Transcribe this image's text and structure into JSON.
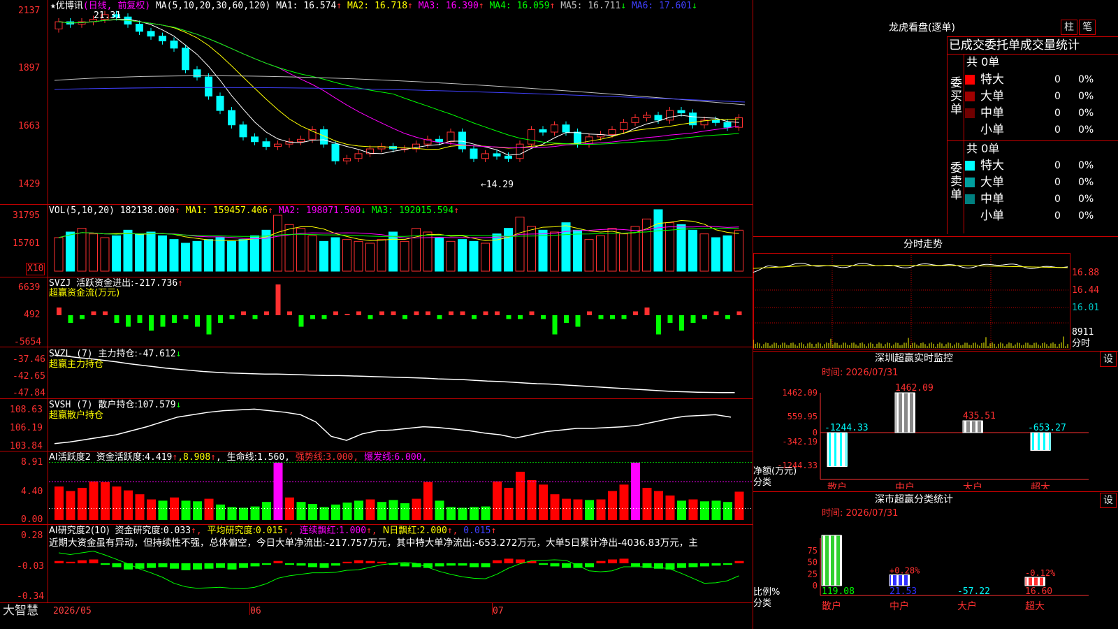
{
  "stock": {
    "name": "优博讯",
    "period": "(日线, 前复权)",
    "ma_params": "MA(5,10,20,30,60,120)",
    "ma": [
      {
        "label": "MA1:",
        "value": "16.574",
        "arrow": "↑",
        "color": "#ffffff"
      },
      {
        "label": "MA2:",
        "value": "16.718",
        "arrow": "↑",
        "color": "#ffff00"
      },
      {
        "label": "MA3:",
        "value": "16.390",
        "arrow": "↑",
        "color": "#ff00ff"
      },
      {
        "label": "MA4:",
        "value": "16.059",
        "arrow": "↑",
        "color": "#00ff00"
      },
      {
        "label": "MA5:",
        "value": "16.711",
        "arrow": "↓",
        "color": "#c0c0c0"
      },
      {
        "label": "MA6:",
        "value": "17.601",
        "arrow": "↓",
        "color": "#4040ff"
      }
    ],
    "price_axis": [
      "2137",
      "1897",
      "1663",
      "1429"
    ],
    "high_mark": "21.31",
    "low_mark": "←14.29"
  },
  "vol": {
    "title": "VOL(5,10,20)",
    "value": "182138.000",
    "ma": [
      {
        "label": "MA1:",
        "value": "159457.406",
        "arrow": "↑",
        "color": "#ffff00"
      },
      {
        "label": "MA2:",
        "value": "198071.500",
        "arrow": "↓",
        "color": "#ff00ff"
      },
      {
        "label": "MA3:",
        "value": "192015.594",
        "arrow": "↑",
        "color": "#00ff00"
      }
    ],
    "axis": [
      "31795",
      "15701"
    ],
    "unit": "X10"
  },
  "svzj": {
    "title": "SVZJ",
    "label": "活跃资金进出:",
    "value": "-217.736",
    "arrow": "↑",
    "subtitle": "超赢资金流(万元)",
    "axis": [
      "6639",
      "492",
      "-5654"
    ]
  },
  "svzl": {
    "title": "SVZL (7)",
    "label": "主力持仓:",
    "value": "-47.612",
    "arrow": "↓",
    "subtitle": "超赢主力持仓",
    "axis": [
      "-37.46",
      "-42.65",
      "-47.84"
    ]
  },
  "svsh": {
    "title": "SVSH (7)",
    "label": "散户持仓:",
    "value": "107.579",
    "arrow": "↓",
    "subtitle": "超赢散户持仓",
    "axis": [
      "108.63",
      "106.19",
      "103.84"
    ]
  },
  "ai1": {
    "title": "AI活跃度2",
    "label": "资金活跃度:",
    "value": "4.419",
    "arrow": "↑",
    "v2": "8.908",
    "life_label": "生命线:",
    "life_value": "1.560",
    "strong_label": "强势线:",
    "strong_value": "3.000",
    "burst_label": "爆发线:",
    "burst_value": "6.000",
    "axis": [
      "8.91",
      "4.40",
      "0.00"
    ]
  },
  "ai2": {
    "title": "AI研究度2(10)",
    "label": "资金研究度:",
    "value": "0.033",
    "avg_label": "平均研究度:",
    "avg_value": "0.015",
    "lian_label": "连续飘红:",
    "lian_value": "1.000",
    "n_label": "N日飘红:",
    "n_value": "2.000",
    "last_value": "0.015",
    "comment": "近期大资金虽有异动，但持续性不强，总体偏空，今日大单净流出:-217.757万元，其中特大单净流出:-653.272万元，大单5日累计净出-4036.83万元，主",
    "axis": [
      "0.28",
      "-0.03",
      "-0.34"
    ]
  },
  "bottom": {
    "brand": "大智慧",
    "dates": [
      "2026/05",
      "06",
      "07"
    ]
  },
  "lhb": {
    "title": "龙虎看盘(逐单)",
    "btn1": "柱",
    "btn2": "笔",
    "header": "已成交委托单成交量统计",
    "buy_label": "委买单",
    "sell_label": "委卖单",
    "buy_total": "共 0单",
    "sell_total": "共 0单",
    "buy_rows": [
      {
        "name": "特大",
        "val": "0",
        "pct": "0%",
        "color": "#ff0000"
      },
      {
        "name": "大单",
        "val": "0",
        "pct": "0%",
        "color": "#a00000"
      },
      {
        "name": "中单",
        "val": "0",
        "pct": "0%",
        "color": "#700000"
      },
      {
        "name": "小单",
        "val": "0",
        "pct": "0%",
        "color": "#000000"
      }
    ],
    "sell_rows": [
      {
        "name": "特大",
        "val": "0",
        "pct": "0%",
        "color": "#00ffff"
      },
      {
        "name": "大单",
        "val": "0",
        "pct": "0%",
        "color": "#00a0a0"
      },
      {
        "name": "中单",
        "val": "0",
        "pct": "0%",
        "color": "#008080"
      },
      {
        "name": "小单",
        "val": "0",
        "pct": "0%",
        "color": "#000000"
      }
    ]
  },
  "intraday": {
    "title": "分时走势",
    "axis": [
      "16.88",
      "16.44",
      "16.01"
    ],
    "vol_label": "8911",
    "vol_unit": "分时"
  },
  "sz_monitor": {
    "title": "深圳超赢实时监控",
    "btn": "设",
    "time": "时间: 2026/07/31",
    "axis": [
      "1462.09",
      "559.95",
      "0",
      "-342.19",
      "-1244.33"
    ],
    "ylabel1": "净额(万元)",
    "ylabel2": "分类",
    "categories": [
      "散户",
      "中户",
      "大户",
      "超大"
    ],
    "values": [
      -1244.33,
      1462.09,
      435.51,
      -653.27
    ],
    "value_labels": [
      "-1244.33",
      "1462.09",
      "435.51",
      "-653.27"
    ]
  },
  "sz_class": {
    "title": "深市超赢分类统计",
    "btn": "设",
    "time": "时间: 2026/07/31",
    "axis": [
      "75",
      "50",
      "25",
      "0"
    ],
    "ylabel1": "比例%",
    "ylabel2": "分类",
    "categories": [
      "散户",
      "中户",
      "大户",
      "超大"
    ],
    "values": [
      119.08,
      21.53,
      -57.22,
      16.6
    ],
    "value_labels": [
      "119.08",
      "21.53",
      "-57.22",
      "16.60"
    ],
    "bar_pct": [
      100,
      21.53,
      0,
      16.6
    ],
    "pct_labels": [
      "",
      "+0.28%",
      "",
      "-0.12%"
    ]
  },
  "chart_data": [
    {
      "type": "candlestick",
      "title": "优博讯 (日线, 前复权)",
      "ylim": [
        14.29,
        21.37
      ],
      "high": 21.31,
      "low": 14.29,
      "close_series": [
        20.9,
        20.8,
        20.9,
        21.0,
        21.2,
        21.1,
        20.8,
        20.5,
        20.3,
        20.1,
        19.8,
        18.9,
        18.6,
        17.8,
        17.2,
        16.6,
        16.1,
        15.9,
        15.7,
        15.8,
        15.9,
        16.0,
        16.4,
        15.8,
        15.1,
        15.2,
        15.4,
        15.6,
        15.7,
        15.6,
        15.6,
        15.8,
        16.0,
        15.9,
        16.3,
        15.6,
        15.2,
        15.4,
        15.3,
        15.2,
        15.8,
        16.4,
        16.3,
        16.6,
        16.3,
        15.8,
        16.1,
        16.2,
        16.4,
        16.7,
        16.9,
        17.0,
        16.8,
        17.2,
        17.1,
        16.6,
        16.8,
        16.7,
        16.5,
        16.9
      ]
    },
    {
      "type": "bar",
      "title": "VOL(5,10,20)",
      "ylim": [
        0,
        31795
      ],
      "values": [
        18,
        21,
        23,
        20,
        18,
        19,
        22,
        20,
        21,
        19,
        17,
        15,
        16,
        17,
        18,
        16,
        17,
        19,
        22,
        30,
        25,
        23,
        19,
        16,
        18,
        17,
        16,
        15,
        17,
        21,
        16,
        23,
        21,
        18,
        16,
        17,
        16,
        15,
        20,
        23,
        29,
        24,
        22,
        21,
        26,
        22,
        17,
        19,
        23,
        20,
        24,
        28,
        33,
        26,
        25,
        22,
        20,
        18,
        19,
        22
      ]
    },
    {
      "type": "bar",
      "title": "SVZJ 活跃资金进出",
      "ylim": [
        -5654,
        6639
      ],
      "values": [
        2,
        -2,
        -1,
        1,
        1,
        -2,
        -3,
        -2,
        -4,
        -3,
        -2,
        -1,
        -3,
        -5,
        -2,
        -1,
        1,
        -1,
        1,
        8,
        1,
        -3,
        -1,
        -1,
        1,
        0,
        1,
        -1,
        1,
        1,
        -1,
        1,
        1,
        -1,
        1,
        1,
        -1,
        1,
        1,
        -1,
        -1,
        1,
        -1,
        -5,
        -2,
        -3,
        1,
        -1,
        -1,
        -1,
        1,
        2,
        -5,
        -2,
        -4,
        -2,
        -1,
        1,
        -1,
        1
      ]
    },
    {
      "type": "line",
      "title": "SVZL (7) 主力持仓",
      "ylim": [
        -47.84,
        -37.46
      ],
      "values": [
        -37.5,
        -37.8,
        -38.2,
        -38.5,
        -38.9,
        -39.3,
        -39.8,
        -40.2,
        -40.6,
        -41.0,
        -41.3,
        -41.6,
        -41.9,
        -42.1,
        -42.3,
        -42.4,
        -42.5,
        -42.6,
        -42.6,
        -42.7,
        -42.8,
        -42.9,
        -43.0,
        -43.0,
        -43.1,
        -43.2,
        -43.3,
        -43.4,
        -43.5,
        -43.6,
        -43.7,
        -43.9,
        -44.0,
        -44.1,
        -44.3,
        -44.5,
        -44.6,
        -44.8,
        -45.0,
        -45.2,
        -45.3,
        -45.5,
        -45.7,
        -45.9,
        -46.1,
        -46.3,
        -46.5,
        -46.7,
        -46.9,
        -47.1,
        -47.3,
        -47.4,
        -47.5,
        -47.55,
        -47.6,
        -47.61
      ]
    },
    {
      "type": "line",
      "title": "SVSH (7) 散户持仓",
      "ylim": [
        103.84,
        108.63
      ],
      "values": [
        104.3,
        104.5,
        104.8,
        105.1,
        105.4,
        105.9,
        106.4,
        107.0,
        107.6,
        107.9,
        108.2,
        108.4,
        108.5,
        108.6,
        108.4,
        108.2,
        107.9,
        107.0,
        105.2,
        104.7,
        105.5,
        105.9,
        106.0,
        106.2,
        106.4,
        106.3,
        106.1,
        105.9,
        105.6,
        105.4,
        105.0,
        105.4,
        105.8,
        106.0,
        106.2,
        106.2,
        106.3,
        106.4,
        106.6,
        107.0,
        107.4,
        107.7,
        107.8,
        107.9,
        107.6
      ]
    },
    {
      "type": "bar",
      "title": "AI活跃度2 资金活跃度",
      "ylim": [
        0,
        8.91
      ],
      "values": [
        5.2,
        4.5,
        5.0,
        6.0,
        5.9,
        5.2,
        4.6,
        4.0,
        3.2,
        3.0,
        3.5,
        3.0,
        2.9,
        3.3,
        2.4,
        2.0,
        1.9,
        2.1,
        2.8,
        8.9,
        3.5,
        2.8,
        2.5,
        2.0,
        2.4,
        2.7,
        3.0,
        3.2,
        2.8,
        3.1,
        2.6,
        3.3,
        5.9,
        3.0,
        2.0,
        1.9,
        2.0,
        2.1,
        6.0,
        5.0,
        7.5,
        6.2,
        5.5,
        4.0,
        3.3,
        3.2,
        3.1,
        3.2,
        4.5,
        5.5,
        8.9,
        5.0,
        4.5,
        3.8,
        3.0,
        3.2,
        2.9,
        3.0,
        2.8,
        4.4
      ]
    },
    {
      "type": "bar",
      "title": "AI研究度2(10) 资金研究度",
      "ylim": [
        -0.34,
        0.28
      ],
      "values": [
        0.03,
        0.02,
        0.04,
        0.05,
        -0.02,
        -0.05,
        -0.08,
        -0.07,
        -0.06,
        -0.05,
        -0.07,
        -0.09,
        -0.08,
        -0.07,
        -0.06,
        -0.08,
        -0.06,
        -0.04,
        -0.02,
        0.03,
        -0.02,
        -0.03,
        -0.05,
        -0.06,
        -0.03,
        0.02,
        0.04,
        0.03,
        0.02,
        -0.02,
        -0.04,
        -0.05,
        -0.06,
        -0.04,
        -0.03,
        -0.03,
        -0.05,
        -0.05,
        0.04,
        0.06,
        0.05,
        0.03,
        -0.02,
        -0.04,
        -0.06,
        -0.06,
        -0.05,
        0.03,
        0.05,
        0.06,
        -0.04,
        -0.06,
        -0.07,
        -0.08,
        -0.06,
        -0.05,
        -0.04,
        -0.03,
        -0.02,
        0.03
      ]
    },
    {
      "type": "bar",
      "title": "深圳超赢实时监控",
      "categories": [
        "散户",
        "中户",
        "大户",
        "超大"
      ],
      "values": [
        -1244.33,
        1462.09,
        435.51,
        -653.27
      ],
      "ylim": [
        -1244.33,
        1462.09
      ]
    },
    {
      "type": "bar",
      "title": "深市超赢分类统计",
      "categories": [
        "散户",
        "中户",
        "大户",
        "超大"
      ],
      "values": [
        119.08,
        21.53,
        -57.22,
        16.6
      ],
      "ylim": [
        0,
        75
      ]
    }
  ]
}
